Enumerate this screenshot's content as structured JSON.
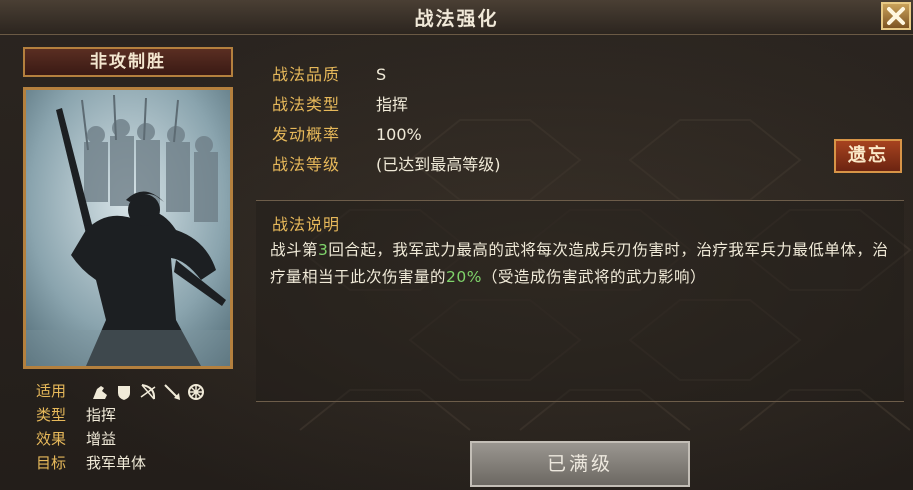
{
  "window": {
    "title": "战法强化"
  },
  "card": {
    "name": "非攻制胜",
    "suit_label": "适用",
    "suit_icons": [
      "cavalry-icon",
      "shield-icon",
      "bow-icon",
      "spear-icon",
      "siege-wheel-icon"
    ],
    "type_label": "类型",
    "type_value": "指挥",
    "effect_label": "效果",
    "effect_value": "增益",
    "target_label": "目标",
    "target_value": "我军单体"
  },
  "attributes": [
    {
      "label": "战法品质",
      "value": "S"
    },
    {
      "label": "战法类型",
      "value": "指挥"
    },
    {
      "label": "发动概率",
      "value": "100%"
    },
    {
      "label": "战法等级",
      "value": "(已达到最高等级)"
    }
  ],
  "forget_button": "遗忘",
  "description": {
    "title": "战法说明",
    "p1": "战斗第",
    "n1": "3",
    "p2": "回合起，我军武力最高的武将每次造成兵刃伤害时，治疗我军兵力最低单体，治疗量相当于此次伤害量的",
    "n2": "20%",
    "p3": "（受造成伤害武将的武力影响）"
  },
  "max_button": "已满级",
  "colors": {
    "label_gold": "#e6b85a",
    "highlight_green": "#7fd36a",
    "forget_red": "#a7431f"
  }
}
